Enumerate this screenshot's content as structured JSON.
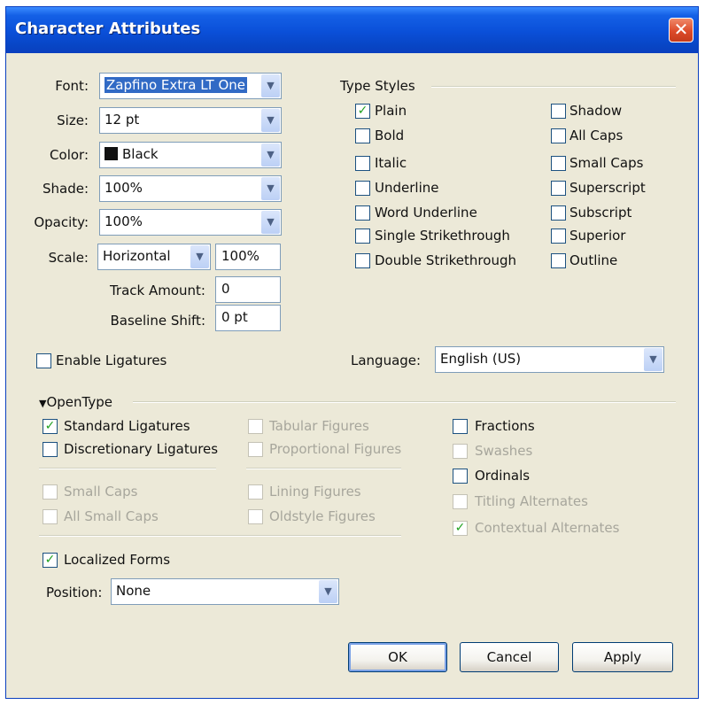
{
  "window": {
    "title": "Character Attributes",
    "close_glyph": "✕"
  },
  "char": {
    "font_label": "Font:",
    "font_value": "Zapfino Extra LT One",
    "size_label": "Size:",
    "size_value": "12 pt",
    "color_label": "Color:",
    "color_value": "Black",
    "shade_label": "Shade:",
    "shade_value": "100%",
    "opacity_label": "Opacity:",
    "opacity_value": "100%",
    "scale_label": "Scale:",
    "scale_axis": "Horizontal",
    "scale_value": "100%",
    "track_label": "Track Amount:",
    "track_value": "0",
    "baseline_label": "Baseline Shift:",
    "baseline_value": "0 pt"
  },
  "type_styles": {
    "header": "Type Styles",
    "left": [
      {
        "label": "Plain",
        "checked": true
      },
      {
        "label": "Bold",
        "checked": false
      },
      {
        "label": "Italic",
        "checked": false
      },
      {
        "label": "Underline",
        "checked": false
      },
      {
        "label": "Word Underline",
        "checked": false
      },
      {
        "label": "Single Strikethrough",
        "checked": false
      },
      {
        "label": "Double Strikethrough",
        "checked": false
      }
    ],
    "right": [
      {
        "label": "Shadow",
        "checked": false
      },
      {
        "label": "All Caps",
        "checked": false
      },
      {
        "label": "Small Caps",
        "checked": false
      },
      {
        "label": "Superscript",
        "checked": false
      },
      {
        "label": "Subscript",
        "checked": false
      },
      {
        "label": "Superior",
        "checked": false
      },
      {
        "label": "Outline",
        "checked": false
      }
    ]
  },
  "ligatures": {
    "label": "Enable Ligatures",
    "checked": false
  },
  "language": {
    "label": "Language:",
    "value": "English (US)"
  },
  "opentype": {
    "header": "OpenType",
    "col1": [
      {
        "label": "Standard Ligatures",
        "checked": true,
        "enabled": true
      },
      {
        "label": "Discretionary Ligatures",
        "checked": false,
        "enabled": true
      },
      {
        "label": "Small Caps",
        "checked": false,
        "enabled": false
      },
      {
        "label": "All Small Caps",
        "checked": false,
        "enabled": false
      }
    ],
    "col2": [
      {
        "label": "Tabular Figures",
        "checked": false,
        "enabled": false
      },
      {
        "label": "Proportional Figures",
        "checked": false,
        "enabled": false
      },
      {
        "label": "Lining Figures",
        "checked": false,
        "enabled": false
      },
      {
        "label": "Oldstyle Figures",
        "checked": false,
        "enabled": false
      }
    ],
    "col3": [
      {
        "label": "Fractions",
        "checked": false,
        "enabled": true
      },
      {
        "label": "Swashes",
        "checked": false,
        "enabled": false
      },
      {
        "label": "Ordinals",
        "checked": false,
        "enabled": true
      },
      {
        "label": "Titling Alternates",
        "checked": false,
        "enabled": false
      },
      {
        "label": "Contextual Alternates",
        "checked": true,
        "enabled": false
      }
    ],
    "localized": {
      "label": "Localized Forms",
      "checked": true
    },
    "position_label": "Position:",
    "position_value": "None"
  },
  "buttons": {
    "ok": "OK",
    "cancel": "Cancel",
    "apply": "Apply"
  },
  "colors": {
    "title_bar": "#0a4fd8",
    "dialog_bg": "#ece9d8",
    "selection": "#316ac5",
    "check": "#21a121"
  }
}
